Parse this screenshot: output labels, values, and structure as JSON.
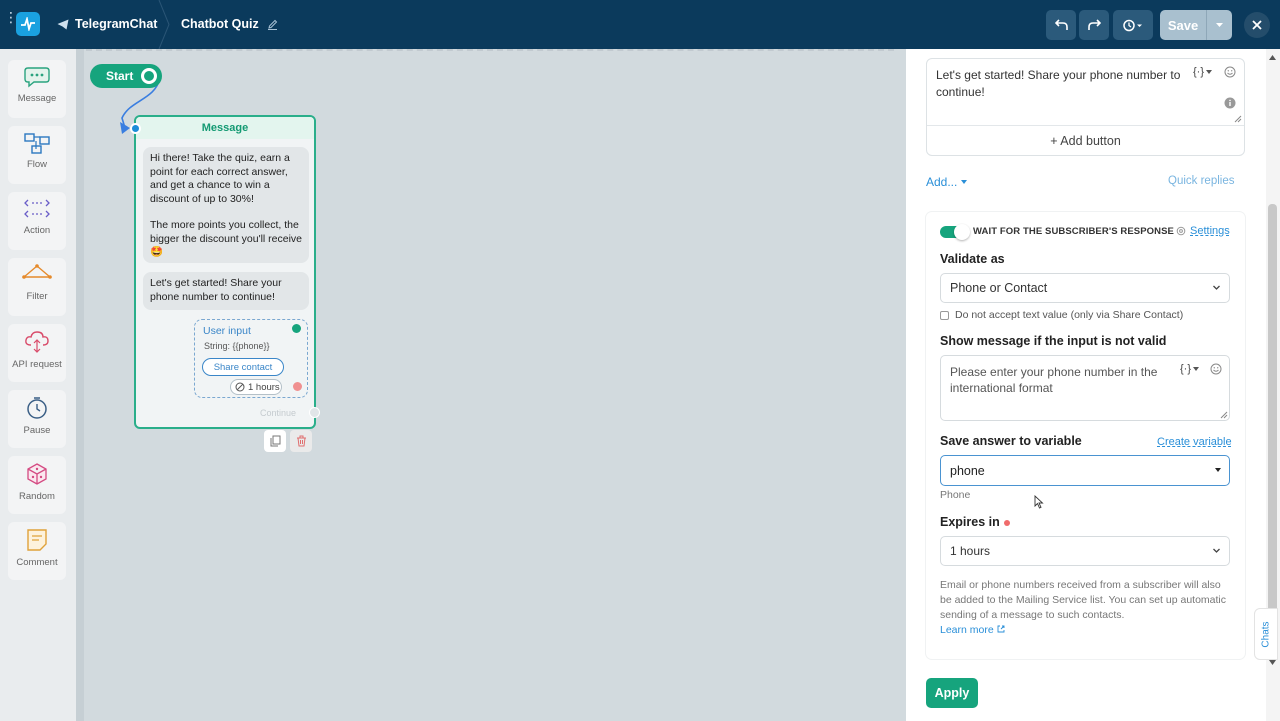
{
  "topbar": {
    "bot_name": "TelegramChat",
    "flow_name": "Chatbot Quiz",
    "save_label": "Save"
  },
  "sidebar": {
    "items": [
      {
        "label": "Message",
        "icon": "message-icon"
      },
      {
        "label": "Flow",
        "icon": "flow-icon"
      },
      {
        "label": "Action",
        "icon": "action-icon"
      },
      {
        "label": "Filter",
        "icon": "filter-icon"
      },
      {
        "label": "API request",
        "icon": "api-request-icon"
      },
      {
        "label": "Pause",
        "icon": "pause-icon"
      },
      {
        "label": "Random",
        "icon": "random-icon"
      },
      {
        "label": "Comment",
        "icon": "comment-icon"
      }
    ]
  },
  "canvas": {
    "start_label": "Start",
    "message_card": {
      "header": "Message",
      "bubble1_line1": "Hi there! Take the quiz, earn a point for each correct answer, and get a chance to win a discount of up to 30%!",
      "bubble1_line2": "The more points you collect, the bigger the discount you'll receive 🤩",
      "bubble2": "Let's get started! Share your phone number to continue!",
      "user_input": {
        "title": "User input",
        "string": "String: {{phone}}",
        "share_button": "Share contact",
        "hours": "1 hours"
      },
      "continue_label": "Continue"
    }
  },
  "panel": {
    "message_text": "Let's get started! Share your phone number to continue!",
    "add_button_label": "+ Add button",
    "add_link": "Add...",
    "quick_replies": "Quick replies",
    "wait": {
      "label": "WAIT FOR THE SUBSCRIBER'S RESPONSE",
      "settings": "Settings",
      "validate_label": "Validate as",
      "validate_value": "Phone or Contact",
      "checkbox_label": "Do not accept text value (only via Share Contact)",
      "invalid_label": "Show message if the input is not valid",
      "invalid_text": "Please enter your phone number in the international format",
      "save_label": "Save answer to variable",
      "create_variable": "Create variable",
      "variable_value": "phone",
      "variable_hint": "Phone",
      "expires_label": "Expires in",
      "expires_value": "1 hours",
      "note": "Email or phone numbers received from a subscriber will also be added to the Mailing Service list. You can set up automatic sending of a message to such contacts.",
      "learn_more": "Learn more"
    },
    "apply_label": "Apply",
    "chats_tab": "Chats"
  },
  "colors": {
    "topbar": "#0b3a5c",
    "accent_green": "#16a47d",
    "link_blue": "#2a8fd8",
    "canvas": "#d2dade"
  }
}
